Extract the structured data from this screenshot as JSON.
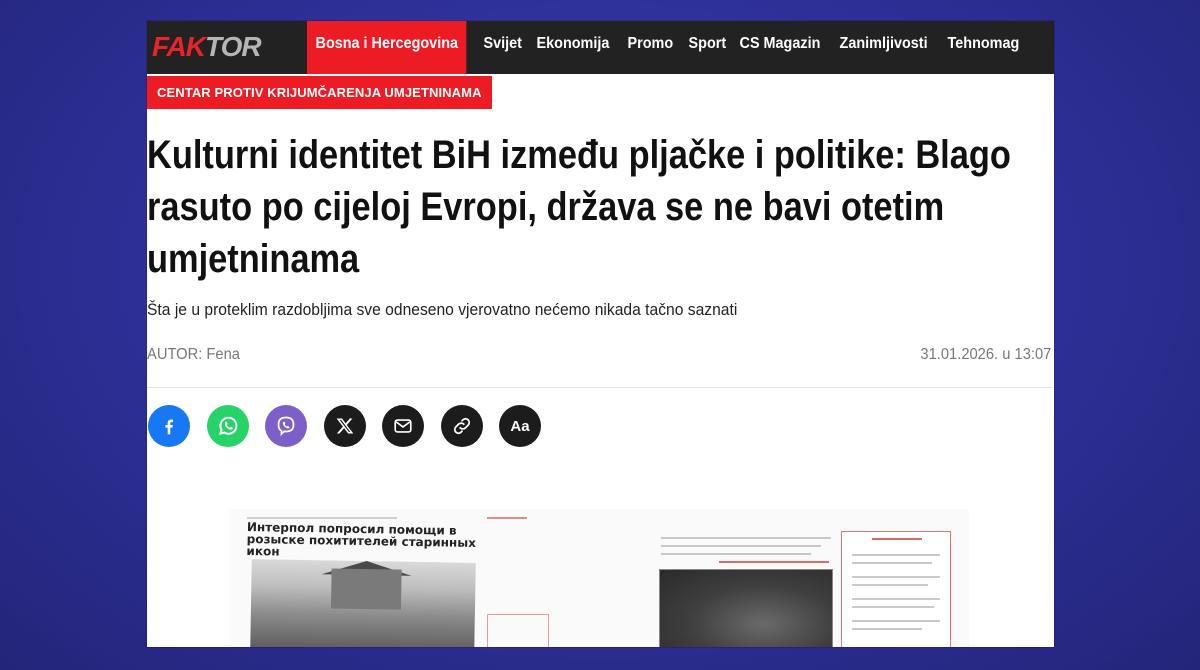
{
  "site": {
    "logo_part1": "FAK",
    "logo_part2": "TOR"
  },
  "nav": {
    "items": [
      {
        "label": "Bosna i Hercegovina",
        "active": true
      },
      {
        "label": "Svijet",
        "active": false
      },
      {
        "label": "Ekonomija",
        "active": false
      },
      {
        "label": "Promo",
        "active": false
      },
      {
        "label": "Sport",
        "active": false
      },
      {
        "label": "CS Magazin",
        "active": false
      },
      {
        "label": "Zanimljivosti",
        "active": false
      },
      {
        "label": "Tehnomag",
        "active": false
      }
    ]
  },
  "article": {
    "category": "CENTAR PROTIV KRIJUMČARENJA UMJETNINAMA",
    "headline": "Kulturni identitet BiH između pljačke i politike: Blago rasuto po cijeloj Evropi, država se ne bavi otetim umjetninama",
    "subtitle": "Šta je u proteklim razdobljima sve odneseno vjerovatno nećemo nikada tačno saznati",
    "author": "AUTOR: Fena",
    "date": "31.01.2026. u 13:07",
    "image_caption_ru": "Интерпол попросил помощи в розыске похитителей старинных икон"
  },
  "share": {
    "buttons": [
      {
        "name": "facebook",
        "icon": "facebook-icon"
      },
      {
        "name": "whatsapp",
        "icon": "whatsapp-icon"
      },
      {
        "name": "viber",
        "icon": "viber-icon"
      },
      {
        "name": "x",
        "icon": "x-icon"
      },
      {
        "name": "email",
        "icon": "mail-icon"
      },
      {
        "name": "copy-link",
        "icon": "link-icon"
      },
      {
        "name": "font-size",
        "icon": "font-size-icon",
        "label": "Aa"
      }
    ]
  },
  "colors": {
    "accent": "#ed1c24",
    "topbar": "#222222",
    "background": "#2d2f96",
    "facebook": "#1877f2",
    "whatsapp": "#25d366",
    "viber": "#7d5fc9"
  }
}
